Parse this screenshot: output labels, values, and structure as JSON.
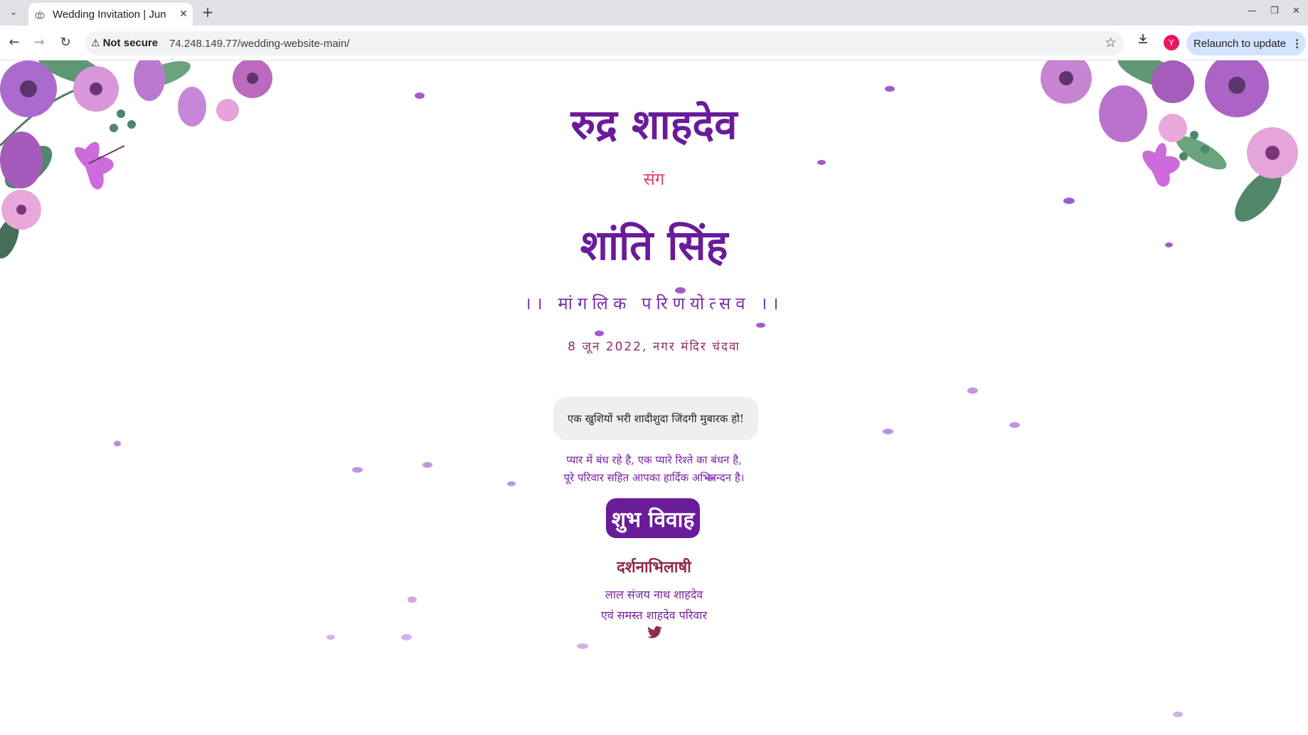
{
  "browser": {
    "tab_title": "Wedding Invitation | Jun",
    "url": "74.248.149.77/wedding-website-main/",
    "security_label": "Not secure",
    "relaunch_label": "Relaunch to update",
    "profile_initial": "Y"
  },
  "invitation": {
    "groom_name": "रुद्र शाहदेव",
    "connector": "संग",
    "bride_name": "शांति सिंह",
    "occasion": "।। मांगलिक परिणयोत्सव ।।",
    "date_venue": "8 जून 2022, नगर मंदिर चंदवा",
    "wish": "एक खुशियों भरी शादीशुदा जिंदगी मुबारक हो!",
    "verse_line1": "प्यार में बंध रहे है, एक प्यारे रिश्ते का बंधन है,",
    "verse_line2": "पूरे परिवार सहित आपका हार्दिक अभिनन्दन है।",
    "shubh_vivah": "शुभ विवाह",
    "darshanabhilashi": "दर्शनाभिलाषी",
    "family_line1": "लाल संजय नाथ शाहदेव",
    "family_line2": "एवं समस्त शाहदेव परिवार"
  },
  "colors": {
    "accent_purple": "#6a1b9a",
    "connector_pink": "#e0406e",
    "petal": "#8e3ec4"
  },
  "icons": [
    "warning-icon",
    "star-icon",
    "download-icon",
    "bird-icon"
  ]
}
